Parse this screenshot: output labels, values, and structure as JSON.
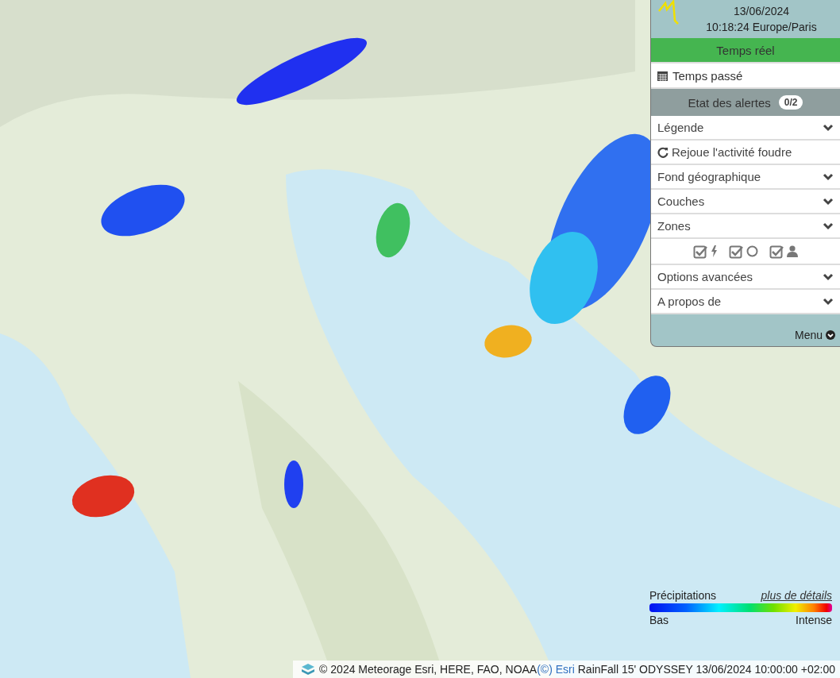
{
  "header": {
    "date": "13/06/2024",
    "time": "10:18:24 Europe/Paris"
  },
  "mode_buttons": [
    {
      "kind": "live",
      "label": "Temps réel",
      "selected": true
    },
    {
      "kind": "history",
      "label": "Temps passé",
      "selected": false
    }
  ],
  "alerts": {
    "label": "Etat des alertes",
    "count": "0/2"
  },
  "menu_items": [
    {
      "kind": "dropdown",
      "label": "Légende",
      "expanded": false
    },
    {
      "kind": "action",
      "label": "Rejoue l'activité foudre"
    },
    {
      "kind": "dropdown",
      "label": "Fond géographique",
      "expanded": false
    },
    {
      "kind": "dropdown",
      "label": "Couches",
      "expanded": false
    },
    {
      "kind": "dropdown",
      "label": "Zones",
      "expanded": false
    },
    {
      "kind": "filters",
      "filters": [
        {
          "kind": "lightning",
          "checked": true
        },
        {
          "kind": "circle",
          "checked": true
        },
        {
          "kind": "person",
          "checked": true
        }
      ]
    },
    {
      "kind": "dropdown",
      "label": "Options avancées",
      "expanded": false
    },
    {
      "kind": "dropdown",
      "label": "A propos de",
      "expanded": false
    }
  ],
  "menu_toggle": "Menu",
  "legend": {
    "title": "Précipitations",
    "link": "plus de détails",
    "low": "Bas",
    "high": "Intense"
  },
  "attribution": {
    "text": "© 2024 Meteorage Esri, HERE, FAO, NOAA",
    "link": "(©) Esri",
    "source": "RainFall 15' ODYSSEY 13/06/2024 10:00:00 +02:00"
  }
}
